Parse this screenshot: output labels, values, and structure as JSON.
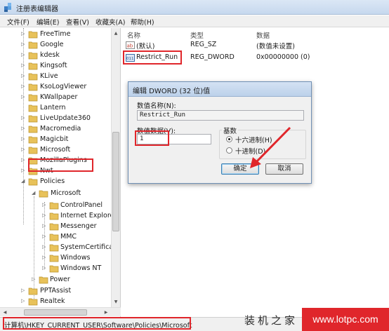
{
  "window": {
    "title": "注册表编辑器"
  },
  "menu": [
    "文件(F)",
    "编辑(E)",
    "查看(V)",
    "收藏夹(A)",
    "帮助(H)"
  ],
  "tree": {
    "items": [
      {
        "label": "FreeTime",
        "top": 0
      },
      {
        "label": "Google"
      },
      {
        "label": "kdesk"
      },
      {
        "label": "Kingsoft"
      },
      {
        "label": "KLive"
      },
      {
        "label": "KsoLogViewer"
      },
      {
        "label": "KWallpaper"
      },
      {
        "label": "Lantern"
      },
      {
        "label": "LiveUpdate360"
      },
      {
        "label": "Macromedia"
      },
      {
        "label": "Magicbit"
      },
      {
        "label": "Microsoft"
      },
      {
        "label": "MozillaPlugins"
      },
      {
        "label": "Nwt"
      },
      {
        "label": "Policies"
      },
      {
        "label": "Microsoft"
      },
      {
        "label": "ControlPanel"
      },
      {
        "label": "Internet Explorer"
      },
      {
        "label": "Messenger"
      },
      {
        "label": "MMC"
      },
      {
        "label": "SystemCertificates"
      },
      {
        "label": "Windows"
      },
      {
        "label": "Windows NT"
      },
      {
        "label": "Power"
      },
      {
        "label": "PPTAssist"
      },
      {
        "label": "Realtek"
      }
    ]
  },
  "list": {
    "columns": {
      "name": "名称",
      "type": "类型",
      "data": "数据"
    },
    "rows": [
      {
        "icon": "string-value-icon",
        "name": "(默认)",
        "type": "REG_SZ",
        "data": "(数值未设置)"
      },
      {
        "icon": "dword-value-icon",
        "name": "Restrict_Run",
        "type": "REG_DWORD",
        "data": "0x00000000 (0)"
      }
    ]
  },
  "dialog": {
    "title": "编辑 DWORD (32 位)值",
    "name_label": "数值名称(N):",
    "name_value": "Restrict_Run",
    "data_label": "数值数据(V):",
    "data_value": "1",
    "base_label": "基数",
    "hex_label": "十六进制(H)",
    "dec_label": "十进制(D)",
    "ok_label": "确定",
    "cancel_label": "取消"
  },
  "status": {
    "path": "计算机\\HKEY_CURRENT_USER\\Software\\Policies\\Microsoft"
  },
  "watermark": {
    "cn": "装机之家",
    "url": "www.lotpc.com"
  },
  "colors": {
    "highlight_red": "#e0262b",
    "folder_yellow": "#e8c25a"
  }
}
